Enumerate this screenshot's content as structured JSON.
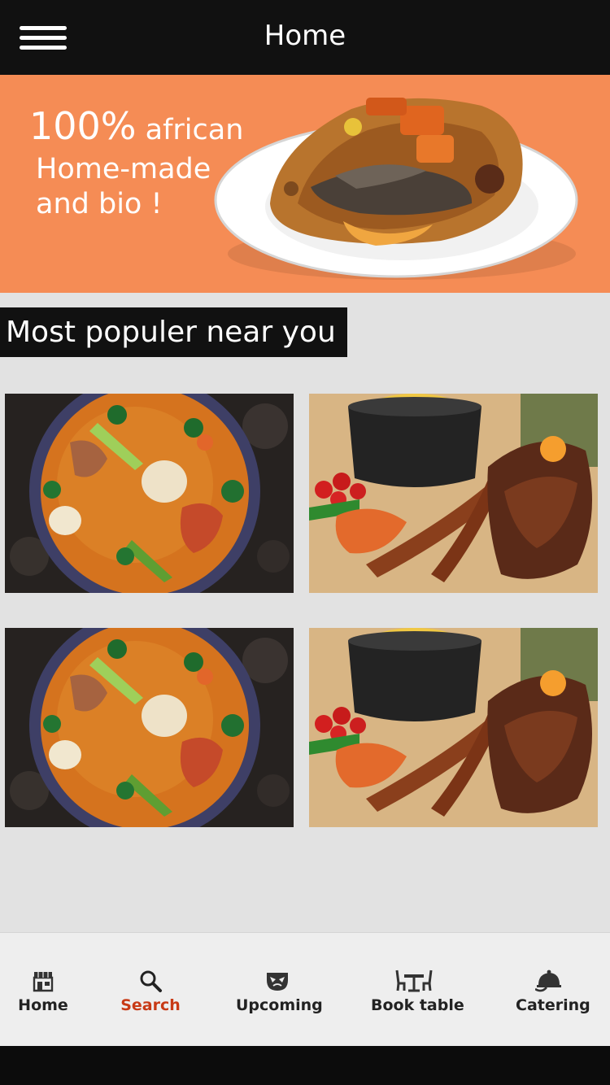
{
  "header": {
    "title": "Home",
    "menu_icon": "hamburger-menu-icon"
  },
  "banner": {
    "line1_big": "100%",
    "line1_small": " african",
    "line2": "Home-made",
    "line3": "and bio !",
    "background_color": "#f58c55"
  },
  "section": {
    "heading": "Most populer near you"
  },
  "grid": {
    "items": [
      {
        "image": "soup-bowl-image"
      },
      {
        "image": "grilled-meat-image"
      },
      {
        "image": "soup-bowl-image"
      },
      {
        "image": "grilled-meat-image"
      }
    ]
  },
  "nav": {
    "active": "Search",
    "active_color": "#c83a16",
    "items": [
      {
        "label": "Home",
        "icon": "storefront-icon"
      },
      {
        "label": "Search",
        "icon": "search-icon"
      },
      {
        "label": "Upcoming",
        "icon": "mask-icon"
      },
      {
        "label": "Book table",
        "icon": "table-chairs-icon"
      },
      {
        "label": "Catering",
        "icon": "cloche-icon"
      }
    ]
  }
}
